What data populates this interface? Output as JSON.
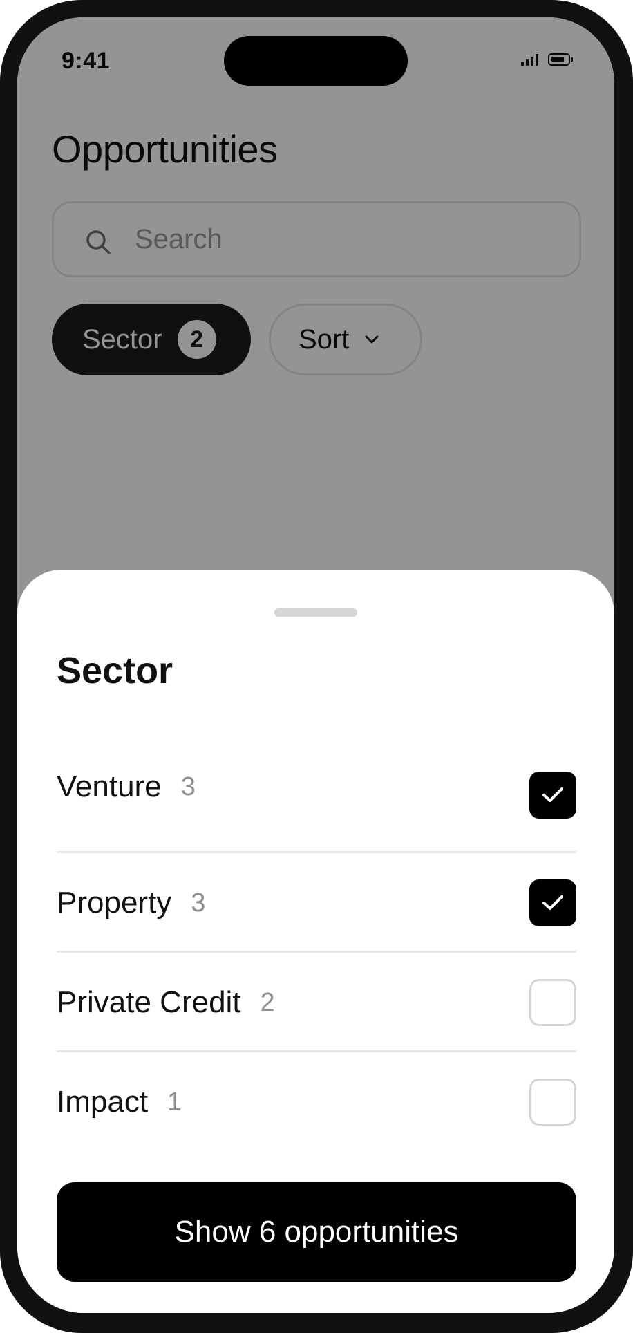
{
  "status_bar": {
    "time": "9:41",
    "icons": [
      "signal-icon",
      "battery-icon"
    ]
  },
  "page": {
    "title": "Opportunities",
    "search": {
      "placeholder": "Search",
      "value": "",
      "icon": "search-icon"
    },
    "filters": {
      "sector_label": "Sector",
      "sector_badge": "2",
      "sort_label": "Sort",
      "sort_icon": "chevron-down-icon"
    }
  },
  "sheet": {
    "title": "Sector",
    "options": [
      {
        "label": "Venture",
        "count": "3",
        "checked": true
      },
      {
        "label": "Property",
        "count": "3",
        "checked": true
      },
      {
        "label": "Private Credit",
        "count": "2",
        "checked": false
      },
      {
        "label": "Impact",
        "count": "1",
        "checked": false
      }
    ],
    "cta_label": "Show 6 opportunities"
  },
  "colors": {
    "accent": "#000000",
    "chip_active": "#1d1d1f",
    "border": "#e3e3e5",
    "muted_text": "#8e8e93",
    "scrim": "rgba(0,0,0,0.42)"
  }
}
